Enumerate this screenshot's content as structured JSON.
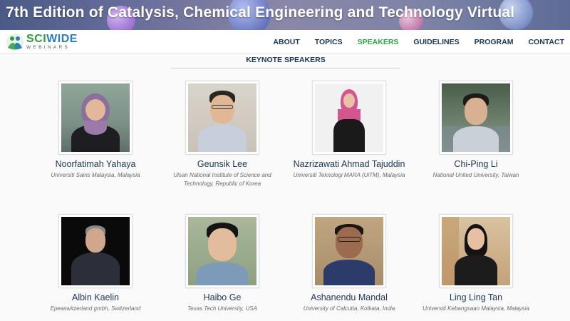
{
  "banner": {
    "title": "7th Edition of Catalysis, Chemical Engineering and Technology Virtual"
  },
  "logo": {
    "main_sci": "SCI",
    "main_wide": "WIDE",
    "sub": "WEBINARS",
    "icon": "people-logo-icon"
  },
  "nav": {
    "items": [
      {
        "label": "ABOUT"
      },
      {
        "label": "TOPICS"
      },
      {
        "label": "SPEAKERS"
      },
      {
        "label": "GUIDELINES"
      },
      {
        "label": "PROGRAM"
      },
      {
        "label": "CONTACT"
      }
    ],
    "active": "SPEAKERS",
    "active_color": "#2aa845",
    "text_color": "#1c3553"
  },
  "section": {
    "title": "KEYNOTE SPEAKERS"
  },
  "speakers": [
    {
      "name": "Noorfatimah Yahaya",
      "affiliation": "Universiti Sains Malaysia, Malaysia"
    },
    {
      "name": "Geunsik Lee",
      "affiliation": "Ulsan National Institute of Science and Technology, Republic of Korea"
    },
    {
      "name": "Nazrizawati Ahmad Tajuddin",
      "affiliation": "Universiti Teknologi MARA (UiTM), Malaysia"
    },
    {
      "name": "Chi-Ping Li",
      "affiliation": "National United University, Taiwan"
    },
    {
      "name": "Albin Kaelin",
      "affiliation": "Epeaswitzerland gmbh, Switzerland"
    },
    {
      "name": "Haibo Ge",
      "affiliation": "Texas Tech University, USA"
    },
    {
      "name": "Ashanendu Mandal",
      "affiliation": "University of Calcutta, Kolkata, India"
    },
    {
      "name": "Ling Ling Tan",
      "affiliation": "Universiti Kebangsaan Malaysia, Malaysia"
    }
  ]
}
